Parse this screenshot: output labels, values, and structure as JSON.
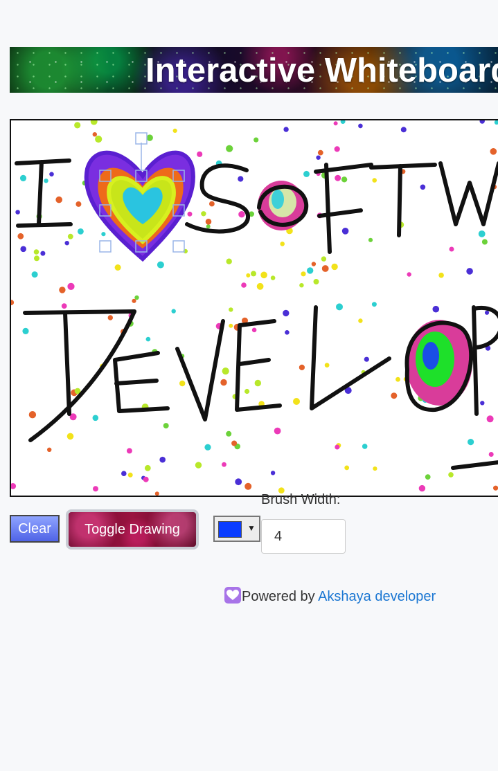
{
  "header": {
    "title": "Interactive Whiteboard"
  },
  "toolbar": {
    "clear_label": "Clear",
    "toggle_label": "Toggle Drawing",
    "color_value": "#0a3cff",
    "brush_width_label": "Brush Width:",
    "brush_width_value": "4"
  },
  "footer": {
    "prefix": "Powered by ",
    "link_text": "Akshaya developer",
    "icon": "purple-heart-icon"
  },
  "canvas": {
    "drawing_text": [
      "I",
      "SOFTW",
      "DEVELOP"
    ],
    "stroke_color": "#111111"
  }
}
